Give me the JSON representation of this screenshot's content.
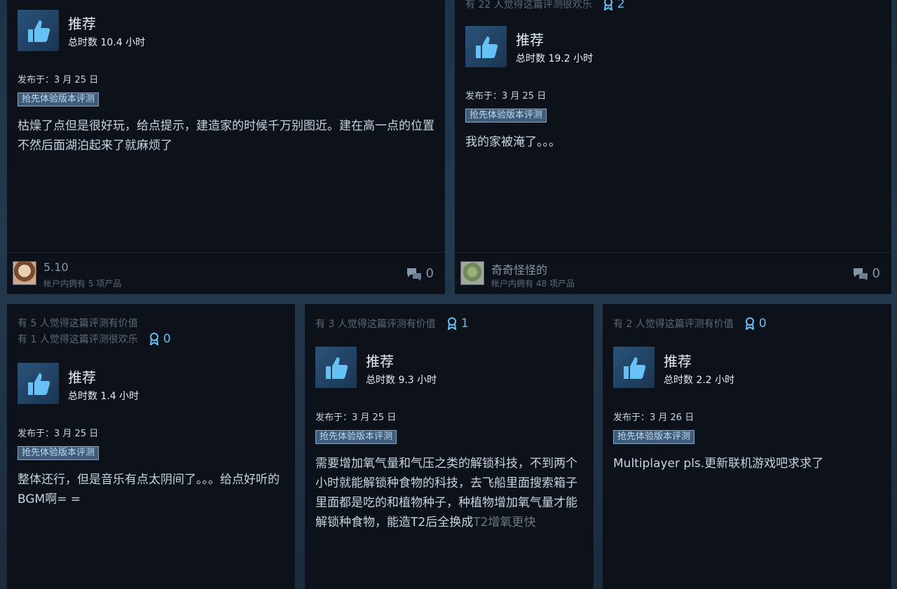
{
  "colors": {
    "card_bg": "#0c111a",
    "accent_blue": "#66c0f4",
    "text_main": "#c6d4df",
    "text_muted": "#5c6a79",
    "tag_bg": "#3e5c7c"
  },
  "icons": {
    "recommend": "thumbs-up-icon",
    "award": "award-ribbon-icon",
    "comments": "comment-bubbles-icon"
  },
  "reviews": [
    {
      "helpful_lines": [],
      "award_count": "",
      "verdict": "推荐",
      "hours": "总时数 10.4 小时",
      "posted": "发布于：3 月 25 日",
      "tag": "抢先体验版本评测",
      "text": "枯燥了点但是很好玩，给点提示，建造家的时候千万别图近。建在高一点的位置不然后面湖泊起来了就麻烦了",
      "text_faded": "",
      "user": "5.10",
      "products": "帐户内拥有 5 项产品",
      "comments": "0"
    },
    {
      "helpful_lines": [
        "有 22 人觉得这篇评测很欢乐"
      ],
      "award_count": "2",
      "verdict": "推荐",
      "hours": "总时数 19.2 小时",
      "posted": "发布于：3 月 25 日",
      "tag": "抢先体验版本评测",
      "text": "我的家被淹了。。。",
      "text_faded": "",
      "user": "奇奇怪怪的",
      "products": "帐户内拥有 48 项产品",
      "comments": "0"
    },
    {
      "helpful_lines": [
        "有 5 人觉得这篇评测有价值",
        "有 1 人觉得这篇评测很欢乐"
      ],
      "award_count": "0",
      "verdict": "推荐",
      "hours": "总时数 1.4 小时",
      "posted": "发布于：3 月 25 日",
      "tag": "抢先体验版本评测",
      "text": "整体还行，但是音乐有点太阴间了。。。给点好听的BGM啊= =",
      "text_faded": ""
    },
    {
      "helpful_lines": [
        "有 3 人觉得这篇评测有价值"
      ],
      "award_count": "1",
      "verdict": "推荐",
      "hours": "总时数 9.3 小时",
      "posted": "发布于：3 月 25 日",
      "tag": "抢先体验版本评测",
      "text": "需要增加氧气量和气压之类的解锁科技，不到两个小时就能解锁种食物的科技，去飞船里面搜索箱子里面都是吃的和植物种子，种植物增加氧气量才能解锁种食物，能造T2后全换成",
      "text_faded": "T2增氧更快"
    },
    {
      "helpful_lines": [
        "有 2 人觉得这篇评测有价值"
      ],
      "award_count": "0",
      "verdict": "推荐",
      "hours": "总时数 2.2 小时",
      "posted": "发布于：3 月 26 日",
      "tag": "抢先体验版本评测",
      "text": "Multiplayer pls.更新联机游戏吧求求了",
      "text_faded": ""
    }
  ]
}
